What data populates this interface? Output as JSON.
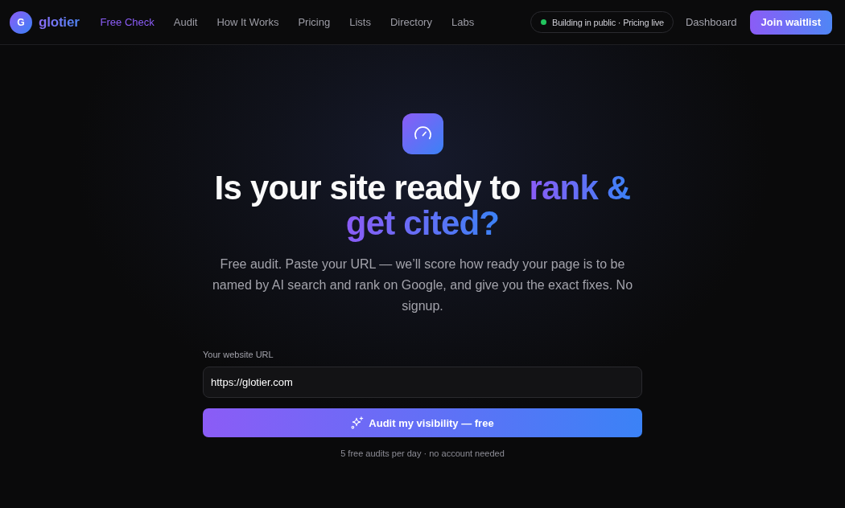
{
  "brand": {
    "initial": "G",
    "name": "glotier"
  },
  "nav": {
    "links": [
      {
        "label": "Free Check",
        "selected": true
      },
      {
        "label": "Audit",
        "selected": false
      },
      {
        "label": "How It Works",
        "selected": false
      },
      {
        "label": "Pricing",
        "selected": false
      },
      {
        "label": "Lists",
        "selected": false
      },
      {
        "label": "Directory",
        "selected": false
      },
      {
        "label": "Labs",
        "selected": false
      }
    ],
    "status_badge": "Building in public · Pricing live",
    "dashboard_link": "Dashboard",
    "cta_button": "Join waitlist"
  },
  "hero": {
    "headline": "Is your site ready to",
    "headline_highlight": "rank & get cited?",
    "subtitle": "Free audit. Paste your URL — we’ll score how ready your page is to be named by AI search and rank on Google, and give you the exact fixes. No signup.",
    "form": {
      "label": "Your website URL",
      "url_value": "https://glotier.com",
      "submit_button": "Audit my visibility — free",
      "note": "5 free audits per day · no account needed"
    }
  }
}
